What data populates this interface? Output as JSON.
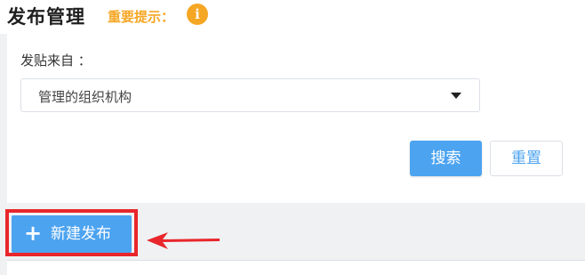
{
  "header": {
    "title": "发布管理",
    "hint_label": "重要提示：",
    "info_icon": "i"
  },
  "filter": {
    "source_label": "发贴来自 ：",
    "source_value": "管理的组织机构"
  },
  "buttons": {
    "search": "搜索",
    "reset": "重置",
    "new_post_plus": "+",
    "new_post": "新建发布"
  },
  "colors": {
    "accent": "#4ca3f0",
    "hint": "#f5a623",
    "annotation": "#e8262b"
  }
}
